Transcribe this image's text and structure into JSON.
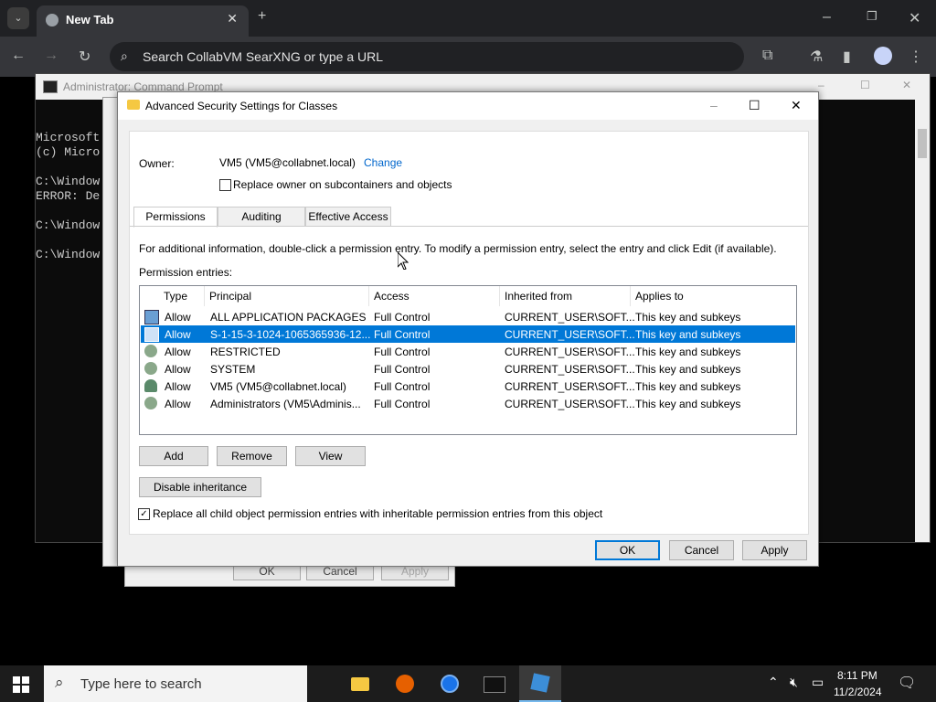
{
  "browser": {
    "tab_title": "New Tab",
    "omnibox_placeholder": "Search CollabVM SearXNG or type a URL"
  },
  "cmd": {
    "title": "Administrator: Command Prompt",
    "lines": [
      "Microsoft",
      "(c) Micro",
      "",
      "C:\\Window",
      "ERROR: De",
      "",
      "C:\\Window",
      "",
      "C:\\Window"
    ]
  },
  "behind_dialog": {
    "ok": "OK",
    "cancel": "Cancel",
    "apply": "Apply"
  },
  "dialog": {
    "title": "Advanced Security Settings for Classes",
    "owner_label": "Owner:",
    "owner_value": "VM5 (VM5@collabnet.local)",
    "change_link": "Change",
    "replace_owner_label": "Replace owner on subcontainers and objects",
    "tabs": [
      "Permissions",
      "Auditing",
      "Effective Access"
    ],
    "info_text": "For additional information, double-click a permission entry. To modify a permission entry, select the entry and click Edit (if available).",
    "entries_label": "Permission entries:",
    "columns": [
      "Type",
      "Principal",
      "Access",
      "Inherited from",
      "Applies to"
    ],
    "rows": [
      {
        "type": "Allow",
        "principal": "ALL APPLICATION PACKAGES",
        "access": "Full Control",
        "inherited": "CURRENT_USER\\SOFT...",
        "applies": "This key and subkeys"
      },
      {
        "type": "Allow",
        "principal": "S-1-15-3-1024-1065365936-12...",
        "access": "Full Control",
        "inherited": "CURRENT_USER\\SOFT...",
        "applies": "This key and subkeys"
      },
      {
        "type": "Allow",
        "principal": "RESTRICTED",
        "access": "Full Control",
        "inherited": "CURRENT_USER\\SOFT...",
        "applies": "This key and subkeys"
      },
      {
        "type": "Allow",
        "principal": "SYSTEM",
        "access": "Full Control",
        "inherited": "CURRENT_USER\\SOFT...",
        "applies": "This key and subkeys"
      },
      {
        "type": "Allow",
        "principal": "VM5 (VM5@collabnet.local)",
        "access": "Full Control",
        "inherited": "CURRENT_USER\\SOFT...",
        "applies": "This key and subkeys"
      },
      {
        "type": "Allow",
        "principal": "Administrators (VM5\\Adminis...",
        "access": "Full Control",
        "inherited": "CURRENT_USER\\SOFT...",
        "applies": "This key and subkeys"
      }
    ],
    "add": "Add",
    "remove": "Remove",
    "view": "View",
    "disable_inheritance": "Disable inheritance",
    "replace_child_label": "Replace all child object permission entries with inheritable permission entries from this object",
    "ok": "OK",
    "cancel": "Cancel",
    "apply": "Apply"
  },
  "taskbar": {
    "search_placeholder": "Type here to search",
    "time": "8:11 PM",
    "date": "11/2/2024"
  },
  "colors": {
    "selection": "#0078d7",
    "link": "#0066cc"
  }
}
